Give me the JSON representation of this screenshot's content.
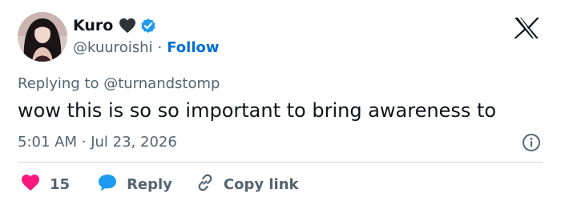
{
  "author": {
    "display_name": "Kuro",
    "handle": "@kuuroishi",
    "separator": "·",
    "follow_label": "Follow"
  },
  "tweet": {
    "reply_prefix": "Replying to",
    "reply_to": "@turnandstomp",
    "text": "wow this is so so important to bring awareness to",
    "time": "5:01 AM",
    "date_separator": "·",
    "date": "Jul 23, 2026"
  },
  "actions": {
    "like_count": "15",
    "reply_label": "Reply",
    "copy_label": "Copy link"
  },
  "icons": {
    "name_emoji": "black-heart-icon",
    "verified": "verified-badge-icon",
    "logo": "x-logo-icon",
    "info": "info-icon",
    "like": "heart-icon",
    "reply": "speech-bubble-icon",
    "copy": "link-icon"
  },
  "colors": {
    "link_blue": "#006fd6",
    "verified_blue": "#1d9bf0",
    "like_pink": "#f91880",
    "secondary_text": "#536471",
    "primary_text": "#0f1419"
  }
}
